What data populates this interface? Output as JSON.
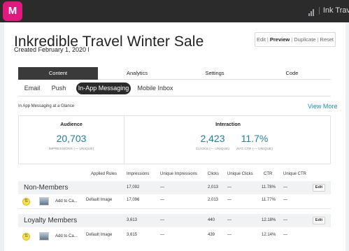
{
  "app": {
    "logo_letter": "M",
    "account": "Ink Travel",
    "account_caret": "▾"
  },
  "campaign": {
    "title": "Inkredible Travel Winter Sale",
    "created": "Created February 1, 2020 l"
  },
  "actions": {
    "edit": "Edit",
    "preview": "Preview",
    "duplicate": "Duplicate",
    "reset": "Reset",
    "sep": "|"
  },
  "tabs": [
    "Content",
    "Analytics",
    "Settings",
    "Code"
  ],
  "subtabs": [
    "Email",
    "Push",
    "In-App Messaging",
    "Mobile Inbox"
  ],
  "active_tab": "Content",
  "active_subtab": "In-App Messaging",
  "glance": {
    "label": "In App Messaging at a Glance",
    "view_more": "View More",
    "audience_heading": "Audience",
    "impressions_value": "20,703",
    "impressions_label": "IMPRESSIONS (— UNIQUE)",
    "interaction_heading": "Interaction",
    "clicks_value": "2,423",
    "clicks_label": "CLICKS (— UNIQUE)",
    "ctr_value": "11.7%",
    "ctr_label": "AVG CTR (— UNIQUE)"
  },
  "table": {
    "columns": {
      "applied_rules": "Applied Rules",
      "impressions": "Impressions",
      "unique_impressions": "Unique Impressions",
      "clicks": "Clicks",
      "unique_clicks": "Unique Clicks",
      "ctr": "CTR",
      "unique_ctr": "Unique CTR"
    },
    "groups": [
      {
        "name": "Non-Members",
        "impressions": "17,092",
        "unique_impressions": "—",
        "clicks": "2,013",
        "unique_clicks": "—",
        "ctr": "11.78%",
        "unique_ctr": "—",
        "edit": "Edit",
        "variant": {
          "icon": "variant-swap-icon",
          "name": "Add to Ca...",
          "rule": "Default Image",
          "impressions": "17,096",
          "unique_impressions": "—",
          "clicks": "2,013",
          "unique_clicks": "—",
          "ctr": "11.77%",
          "unique_ctr": "—"
        }
      },
      {
        "name": "Loyalty Members",
        "impressions": "3,613",
        "unique_impressions": "—",
        "clicks": "440",
        "unique_clicks": "—",
        "ctr": "12.18%",
        "unique_ctr": "—",
        "edit": "Edit",
        "variant": {
          "icon": "variant-swap-icon",
          "name": "Add to Ca...",
          "rule": "Default Image",
          "impressions": "3,615",
          "unique_impressions": "—",
          "clicks": "439",
          "unique_clicks": "—",
          "ctr": "12.14%",
          "unique_ctr": "—"
        }
      }
    ]
  },
  "colors": {
    "brand": "#e0197f",
    "accent": "#1c7fa6",
    "topbar": "#2b2b2b",
    "tab_active": "#3a3a3a",
    "variant_icon": "#f7e24b"
  }
}
